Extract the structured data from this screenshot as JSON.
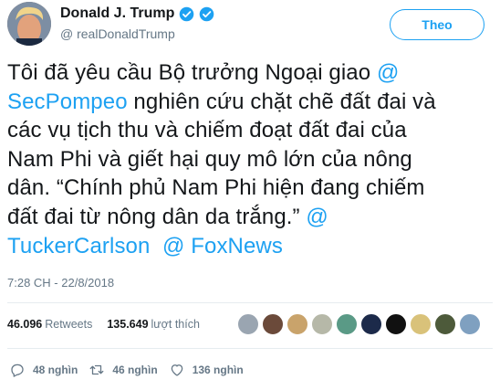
{
  "author": {
    "name": "Donald J. Trump",
    "handle": "@ realDonaldTrump"
  },
  "follow_label": "Theo",
  "tweet": {
    "line1_text": "Tôi đã yêu cầu Bộ trưởng Ngoại giao ",
    "line1_link": "@",
    "line2_link": "SecPompeo",
    "line2_text": " nghiên cứu chặt chẽ đất đai và",
    "line3": "các vụ tịch thu và chiếm đoạt đất đai của",
    "line4": "Nam Phi và giết hại quy mô lớn của nông",
    "line5": "dân. “Chính phủ Nam Phi hiện đang chiếm",
    "line6_text": "đất đai từ nông dân da trắng.” ",
    "line6_link": "@",
    "line7_link1": "TuckerCarlson",
    "line7_sep": "  ",
    "line7_link2": "@ FoxNews"
  },
  "timestamp": "7:28 CH - 22/8/2018",
  "stats": {
    "retweets_count": "46.096",
    "retweets_label": "Retweets",
    "likes_count": "135.649",
    "likes_label": "lượt thích"
  },
  "actions": {
    "reply_count": "48 nghìn",
    "retweet_count": "46 nghìn",
    "like_count": "136 nghìn"
  },
  "colors": {
    "link": "#1da1f2",
    "muted": "#657786",
    "text": "#14171a"
  }
}
